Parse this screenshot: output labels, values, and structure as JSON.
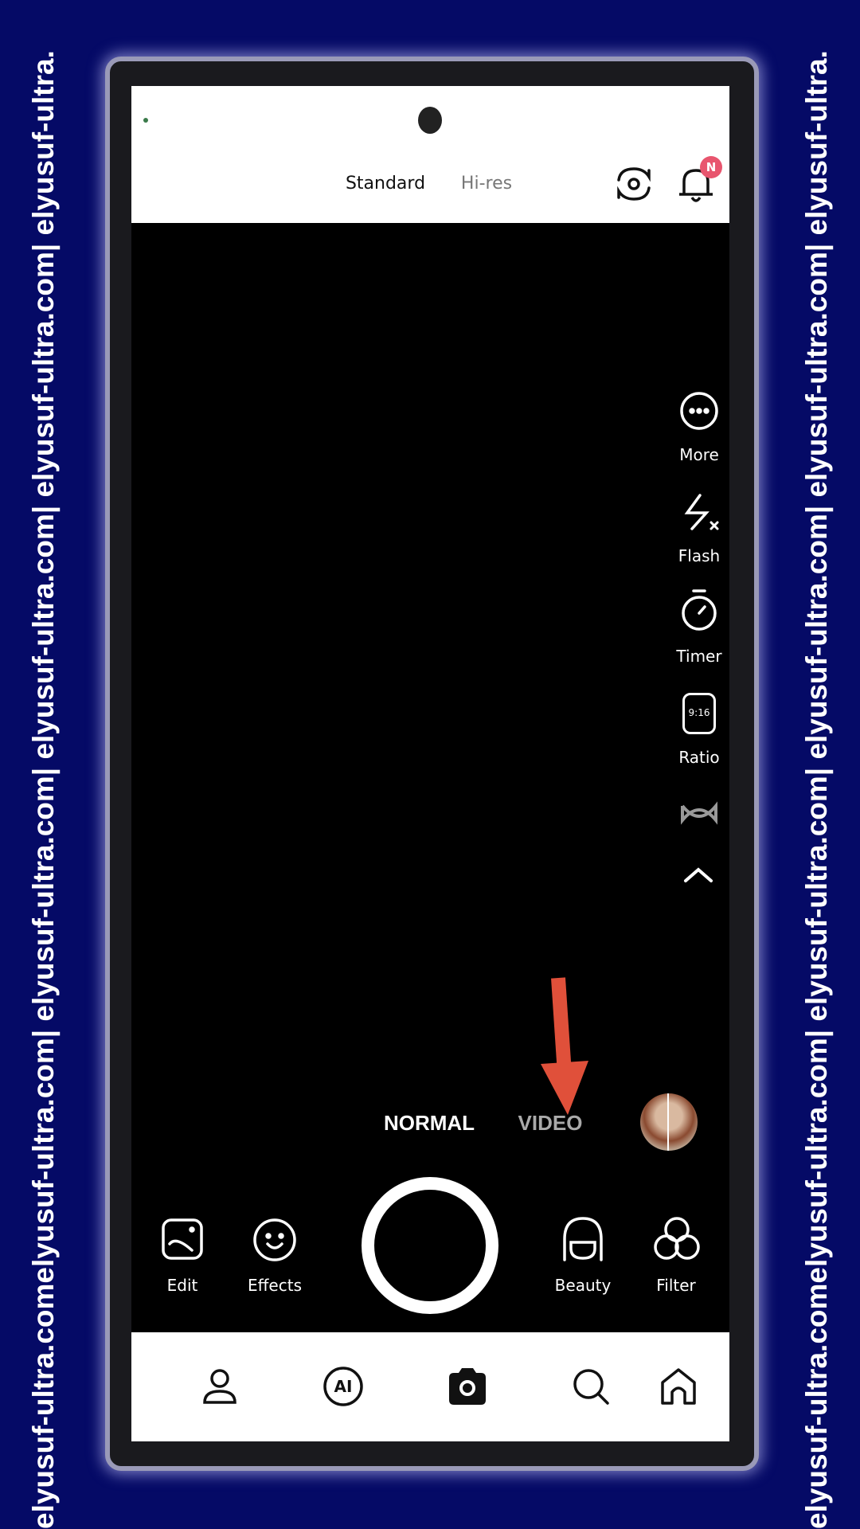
{
  "watermark": "elyusuf-ultra.comelyusuf-ultra.com| elyusuf-ultra.com| elyusuf-ultra.com| elyusuf-ultra.com| elyusuf-ultra.",
  "header": {
    "resolution_options": [
      "Standard",
      "Hi-res"
    ],
    "selected": "Standard",
    "notification_badge": "N",
    "badge_color": "#e8556e"
  },
  "side_tools": [
    {
      "label": "More",
      "icon": "more-icon"
    },
    {
      "label": "Flash",
      "icon": "flash-off-icon"
    },
    {
      "label": "Timer",
      "icon": "timer-icon"
    },
    {
      "label": "Ratio",
      "icon": "ratio-icon",
      "icon_text": "9:16"
    },
    {
      "icon": "infinity-icon"
    },
    {
      "icon": "chevron-up-icon"
    }
  ],
  "modes": {
    "items": [
      "NORMAL",
      "VIDEO"
    ],
    "selected": "NORMAL"
  },
  "tools": [
    {
      "label": "Edit",
      "icon": "image-edit-icon"
    },
    {
      "label": "Effects",
      "icon": "smiley-icon"
    },
    {
      "label": "Beauty",
      "icon": "beauty-icon"
    },
    {
      "label": "Filter",
      "icon": "filter-icon"
    }
  ],
  "bottom_nav": [
    {
      "icon": "profile-icon"
    },
    {
      "icon": "ai-icon",
      "text": "AI"
    },
    {
      "icon": "camera-icon",
      "active": true
    },
    {
      "icon": "search-icon"
    },
    {
      "icon": "home-icon"
    }
  ],
  "annotation": {
    "arrow_color": "#e0503a"
  }
}
